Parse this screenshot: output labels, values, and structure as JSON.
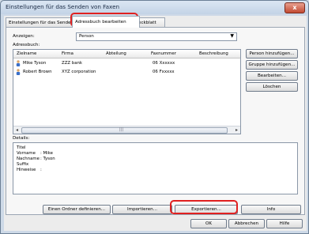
{
  "window": {
    "title": "Einstellungen für das Senden von Faxen",
    "close": "x"
  },
  "tabs": [
    {
      "label": "Einstellungen für das Senden"
    },
    {
      "label": "Adressbuch bearbeiten"
    },
    {
      "label": "eckblatt"
    }
  ],
  "filter": {
    "label": "Anzeigen:",
    "value": "Person",
    "arrow": "▼"
  },
  "address_book": {
    "label": "Adressbuch:",
    "columns": [
      "Zielname",
      "Firma",
      "Abteilung",
      "Faxnummer",
      "Beschreibung"
    ],
    "rows": [
      {
        "name": "Mike Tyson",
        "company": "ZZZ bank",
        "department": "",
        "fax": "06 Xxxxxx",
        "description": ""
      },
      {
        "name": "Robert Brown",
        "company": "XYZ corporation",
        "department": "",
        "fax": "06 Fxxxxx",
        "description": ""
      }
    ],
    "scroll_left": "◂",
    "scroll_right": "▸",
    "scroll_grip": "|||"
  },
  "side_buttons": {
    "add_person": "Person hinzufügen...",
    "add_group": "Gruppe hinzufügen...",
    "edit": "Bearbeiten...",
    "delete": "Löschen"
  },
  "details": {
    "label": "Details:",
    "fields": [
      {
        "key": "Titel",
        "value": ""
      },
      {
        "key": "Vorname",
        "value": ": Mike"
      },
      {
        "key": "Nachname",
        "value": ": Tyson"
      },
      {
        "key": "Suffix",
        "value": ""
      },
      {
        "key": "Hinweise",
        "value": ":"
      }
    ]
  },
  "bottom_buttons": {
    "define_folder": "Einen Ordner definieren...",
    "import": "Importieren...",
    "export": "Exportieren...",
    "info": "Info"
  },
  "dialog_buttons": {
    "ok": "OK",
    "cancel": "Abbrechen",
    "help": "Hilfe"
  }
}
